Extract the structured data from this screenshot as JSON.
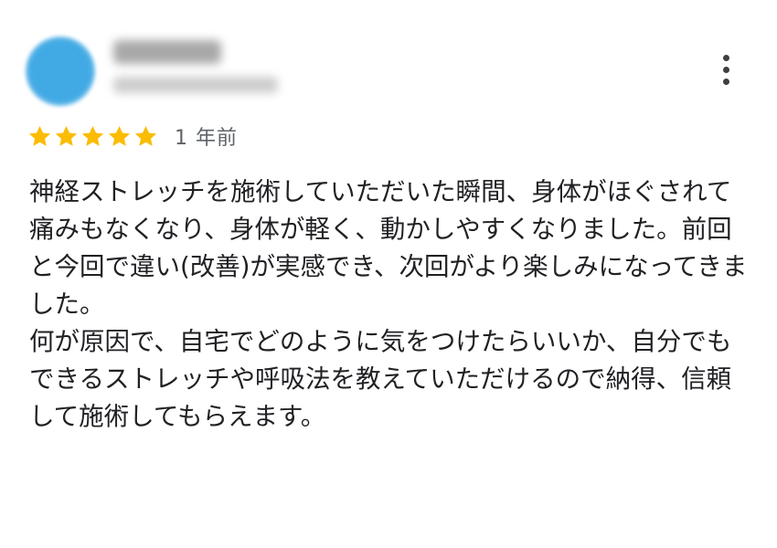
{
  "reviewer": {
    "avatar_color": "#41a9e4"
  },
  "rating": {
    "stars": 5,
    "max": 5,
    "star_color": "#fbbc04"
  },
  "review": {
    "age": "1 年前",
    "text": "神経ストレッチを施術していただいた瞬間、身体がほぐされて痛みもなくなり、身体が軽く、動かしやすくなりました。前回と今回で違い(改善)が実感でき、次回がより楽しみになってきました。\n何が原因で、自宅でどのように気をつけたらいいか、自分でもできるストレッチや呼吸法を教えていただけるので納得、信頼して施術してもらえます。"
  },
  "actions": {
    "more_icon": "more-vert-icon"
  }
}
